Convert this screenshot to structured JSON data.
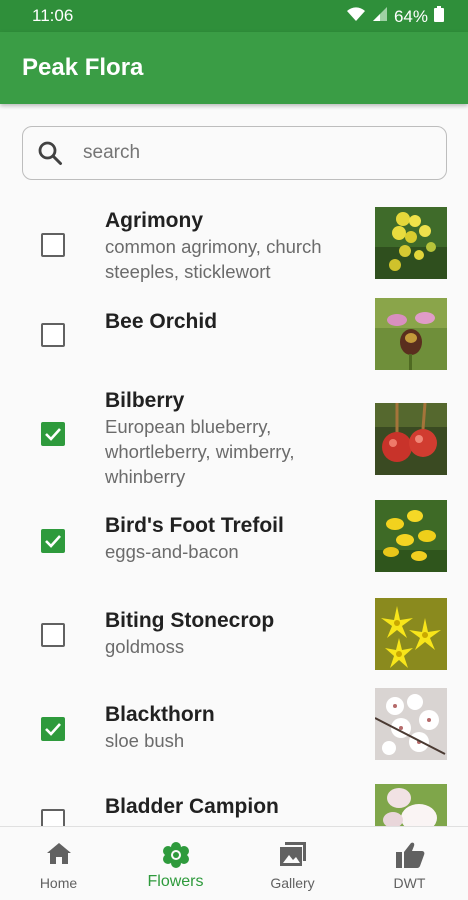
{
  "status_bar": {
    "time": "11:06",
    "battery": "64%"
  },
  "app_bar": {
    "title": "Peak Flora"
  },
  "search": {
    "placeholder": "search",
    "value": ""
  },
  "flowers": [
    {
      "name": "Agrimony",
      "common_names": "common agrimony, church steeples, sticklewort",
      "checked": false,
      "image": "yellow flower spike"
    },
    {
      "name": "Bee Orchid",
      "common_names": "",
      "checked": false,
      "image": "pink bee orchid"
    },
    {
      "name": "Bilberry",
      "common_names": "European blueberry, whortleberry, wimberry, whinberry",
      "checked": true,
      "image": "red bilberry fruits"
    },
    {
      "name": "Bird's Foot Trefoil",
      "common_names": "eggs-and-bacon",
      "checked": true,
      "image": "yellow pea flowers"
    },
    {
      "name": "Biting Stonecrop",
      "common_names": "goldmoss",
      "checked": false,
      "image": "yellow star flowers"
    },
    {
      "name": "Blackthorn",
      "common_names": "sloe bush",
      "checked": true,
      "image": "white blossom"
    },
    {
      "name": "Bladder Campion",
      "common_names": "",
      "checked": false,
      "image": "white campion flower"
    }
  ],
  "bottom_nav": {
    "items": [
      {
        "label": "Home",
        "icon": "home-icon",
        "active": false
      },
      {
        "label": "Flowers",
        "icon": "flower-icon",
        "active": true
      },
      {
        "label": "Gallery",
        "icon": "gallery-icon",
        "active": false
      },
      {
        "label": "DWT",
        "icon": "thumbs-up-icon",
        "active": false
      }
    ]
  },
  "colors": {
    "primary": "#3a9d45",
    "status_bar": "#2f8f3a",
    "checked": "#2e9a3c"
  }
}
